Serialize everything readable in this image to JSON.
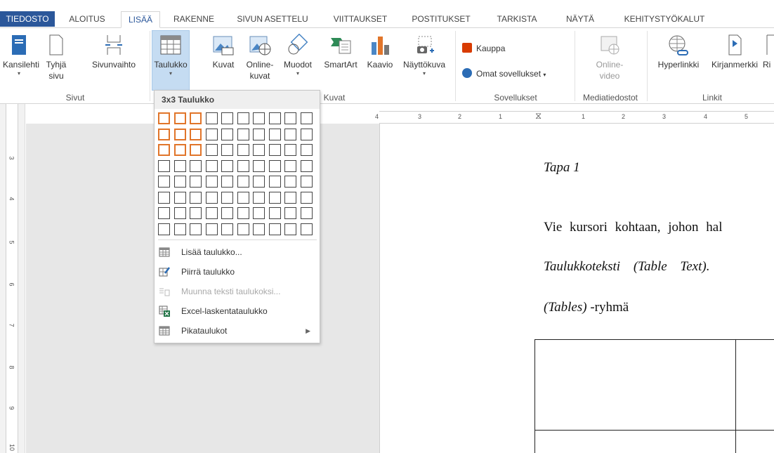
{
  "tabs": [
    "TIEDOSTO",
    "ALOITUS",
    "LISÄÄ",
    "RAKENNE",
    "SIVUN ASETTELU",
    "VIITTAUKSET",
    "POSTITUKSET",
    "TARKISTA",
    "NÄYTÄ",
    "KEHITYSTYÖKALUT"
  ],
  "ribbon": {
    "pages": {
      "cover": "Kansilehti",
      "blank_l1": "Tyhjä",
      "blank_l2": "sivu",
      "break": "Sivunvaihto",
      "group": "Sivut"
    },
    "tables": {
      "table": "Taulukko"
    },
    "illustrations": {
      "pictures": "Kuvat",
      "online_l1": "Online-",
      "online_l2": "kuvat",
      "shapes": "Muodot",
      "smartart": "SmartArt",
      "chart": "Kaavio",
      "screenshot": "Näyttökuva",
      "group": "Kuvat"
    },
    "apps": {
      "store": "Kauppa",
      "myapps": "Omat sovellukset",
      "group": "Sovellukset"
    },
    "media": {
      "video_l1": "Online-",
      "video_l2": "video",
      "group": "Mediatiedostot"
    },
    "links": {
      "hyperlink": "Hyperlinkki",
      "bookmark": "Kirjanmerkki",
      "cross": "Ri",
      "group": "Linkit"
    }
  },
  "dropdown": {
    "title": "3x3 Taulukko",
    "grid": {
      "cols": 10,
      "rows": 8,
      "selected_cols": 3,
      "selected_rows": 3
    },
    "items": [
      {
        "label": "Lisää taulukko...",
        "enabled": true,
        "icon": "table-icon"
      },
      {
        "label": "Piirrä taulukko",
        "enabled": true,
        "icon": "draw-table-icon"
      },
      {
        "label": "Muunna teksti taulukoksi...",
        "enabled": false,
        "icon": "convert-text-icon"
      },
      {
        "label": "Excel-laskentataulukko",
        "enabled": true,
        "icon": "excel-icon"
      },
      {
        "label": "Pikataulukot",
        "enabled": true,
        "icon": "quick-tables-icon"
      }
    ]
  },
  "document": {
    "heading": "Tapa 1",
    "line1": "Vie kursori kohtaan, johon hal",
    "line2": "Taulukkoteksti (Table Text).",
    "line3_italic": "(Tables)",
    "line3_rest": " -ryhmä"
  },
  "ruler": {
    "h_marks": [
      "4",
      "3",
      "2",
      "1",
      "1",
      "2",
      "3",
      "4",
      "5"
    ],
    "v_marks": [
      "3",
      "4",
      "5",
      "6",
      "7",
      "8",
      "9",
      "10"
    ]
  },
  "colors": {
    "file_tab": "#2b579a",
    "accent": "#2b579a",
    "grid_highlight": "#e1752a",
    "selected_button": "#c5dcf2"
  }
}
